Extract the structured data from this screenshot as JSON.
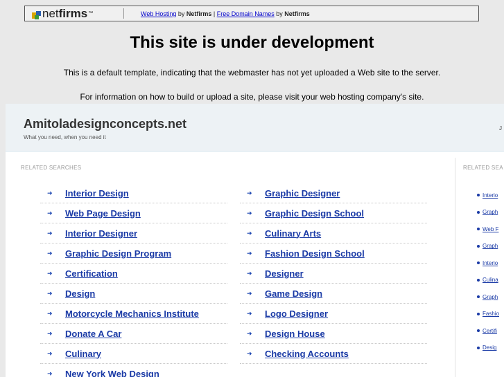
{
  "topbar": {
    "logo_net": "net",
    "logo_firms": "firms",
    "logo_tm": "™",
    "link_web_hosting": "Web Hosting",
    "by_1": " by ",
    "netfirms_1": "Netfirms",
    "separator": " | ",
    "link_domain_names": "Free Domain Names",
    "by_2": " by ",
    "netfirms_2": "Netfirms"
  },
  "main": {
    "heading": "This site is under development",
    "intro_1": "This is a default template, indicating that the webmaster has not yet uploaded a Web site to the server.",
    "intro_2": "For information on how to build or upload a site, please visit your web hosting company's site."
  },
  "parked": {
    "site_title": "Amitoladesignconcepts.net",
    "tagline": "What you need, when you need it",
    "header_right": "J",
    "related_label_left": "RELATED SEARCHES",
    "related_label_right": "RELATED SEA",
    "col1": [
      "Interior Design",
      "Web Page Design",
      "Interior Designer",
      "Graphic Design Program",
      "Certification",
      "Design",
      "Motorcycle Mechanics Institute",
      "Donate A Car",
      "Culinary",
      "New York Web Design"
    ],
    "col2": [
      "Graphic Designer",
      "Graphic Design School",
      "Culinary Arts",
      "Fashion Design School",
      "Designer",
      "Game Design",
      "Logo Designer",
      "Design House",
      "Checking Accounts"
    ],
    "side": [
      "Interio",
      "Graph",
      "Web F",
      "Graph",
      "Interio",
      "Culina",
      "Graph",
      "Fashio",
      "Certifi",
      "Desig"
    ]
  }
}
